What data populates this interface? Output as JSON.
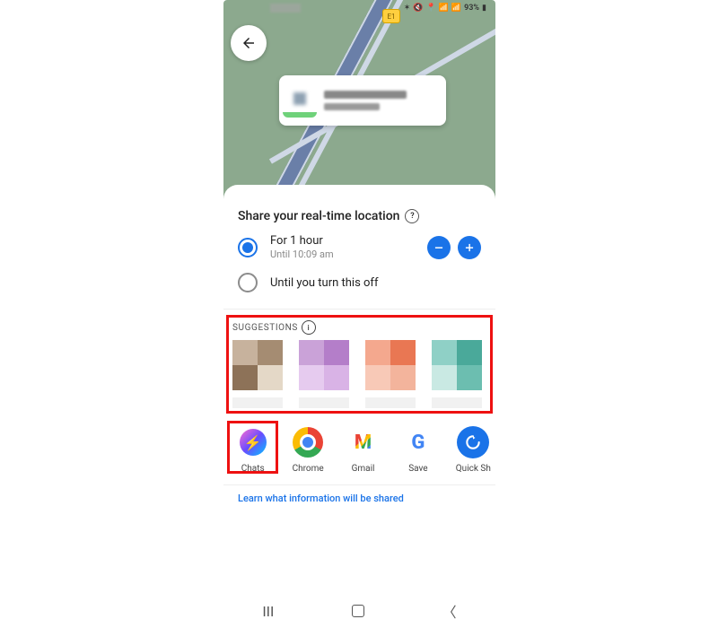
{
  "status": {
    "battery": "93%"
  },
  "map": {
    "route_badge": "E1"
  },
  "share": {
    "title": "Share your real-time location",
    "options": [
      {
        "label": "For 1 hour",
        "sub": "Until 10:09 am",
        "selected": true
      },
      {
        "label": "Until you turn this off",
        "selected": false
      }
    ]
  },
  "suggestions": {
    "label": "SUGGESTIONS"
  },
  "apps": [
    {
      "label": "Chats",
      "icon": "messenger-icon"
    },
    {
      "label": "Chrome",
      "icon": "chrome-icon"
    },
    {
      "label": "Gmail",
      "icon": "gmail-icon"
    },
    {
      "label": "Save",
      "icon": "google-icon"
    },
    {
      "label": "Quick Sh",
      "icon": "quickshare-icon"
    }
  ],
  "footer": {
    "learn": "Learn what information will be shared"
  },
  "colors": {
    "accent": "#1a73e8",
    "annotation": "#e11"
  }
}
